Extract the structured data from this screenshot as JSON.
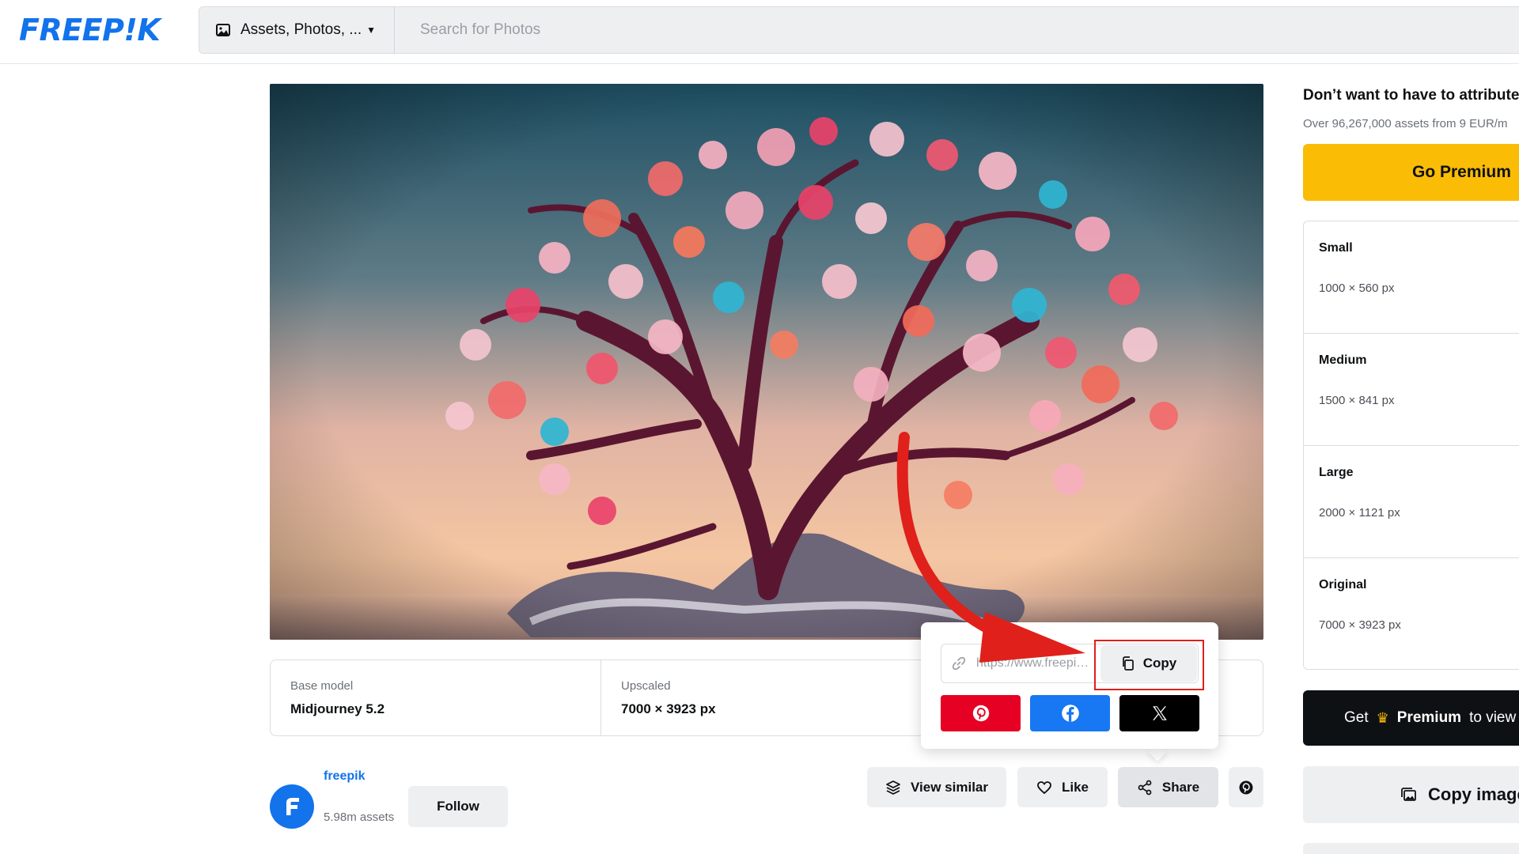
{
  "header": {
    "logo": "FREEP!K",
    "asset_type": "Assets, Photos, ...",
    "search_placeholder": "Search for Photos"
  },
  "image": {
    "subject": "tree-with-pink-blossoms"
  },
  "info": [
    {
      "label": "Base model",
      "value": "Midjourney 5.2"
    },
    {
      "label": "Upscaled",
      "value": "7000 × 3923 px"
    }
  ],
  "author": {
    "name": "freepik",
    "assets": "5.98m assets",
    "follow": "Follow"
  },
  "actions": {
    "view_similar": "View similar",
    "like": "Like",
    "share": "Share"
  },
  "share_popover": {
    "url": "https://www.freepik.com",
    "copy": "Copy",
    "networks": [
      "pinterest",
      "facebook",
      "x"
    ]
  },
  "sidebar": {
    "title": "Don’t want to have to attribute",
    "subtitle": "Over 96,267,000 assets from 9 EUR/m",
    "go_premium": "Go Premium",
    "sizes": [
      {
        "name": "Small",
        "dims": "1000 × 560 px"
      },
      {
        "name": "Medium",
        "dims": "1500 × 841 px"
      },
      {
        "name": "Large",
        "dims": "2000 × 1121 px"
      },
      {
        "name": "Original",
        "dims": "7000 × 3923 px"
      }
    ],
    "get": "Get",
    "premium": "Premium",
    "to_view": "to view",
    "copy_image": "Copy image"
  },
  "colors": {
    "brand_blue": "#1273eb",
    "premium_yellow": "#fbbc05",
    "annotation_red": "#e0201a",
    "pinterest": "#e60023",
    "facebook": "#1877f2"
  }
}
